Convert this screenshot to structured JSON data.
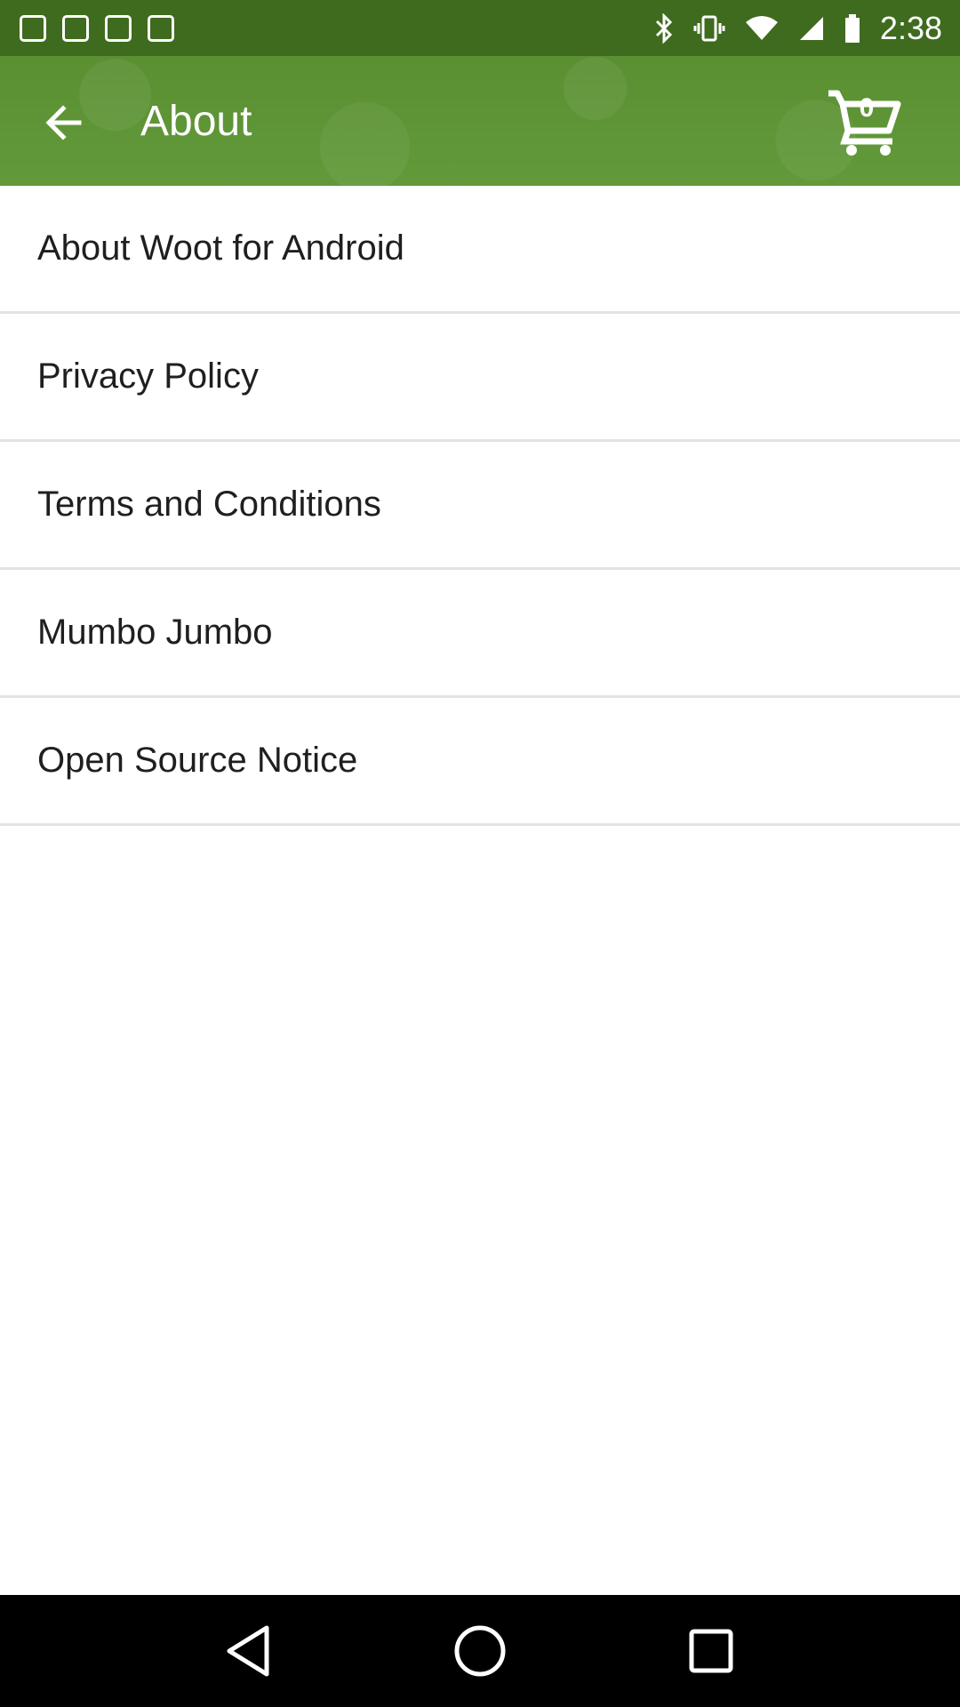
{
  "status_bar": {
    "time": "2:38",
    "icons": [
      "notification-icon",
      "notification-icon",
      "notification-icon",
      "notification-icon",
      "bluetooth-icon",
      "vibrate-icon",
      "wifi-icon",
      "signal-icon",
      "battery-icon"
    ]
  },
  "app_bar": {
    "title": "About",
    "cart_count": "0",
    "back_icon": "arrow-back-icon",
    "cart_icon": "shopping-cart-icon",
    "color": "#5d9235"
  },
  "menu": {
    "items": [
      {
        "label": "About Woot for Android"
      },
      {
        "label": "Privacy Policy"
      },
      {
        "label": "Terms and Conditions"
      },
      {
        "label": "Mumbo Jumbo"
      },
      {
        "label": "Open Source Notice"
      }
    ]
  },
  "nav_bar": {
    "icons": [
      "back-triangle-icon",
      "home-circle-icon",
      "recents-square-icon"
    ]
  }
}
